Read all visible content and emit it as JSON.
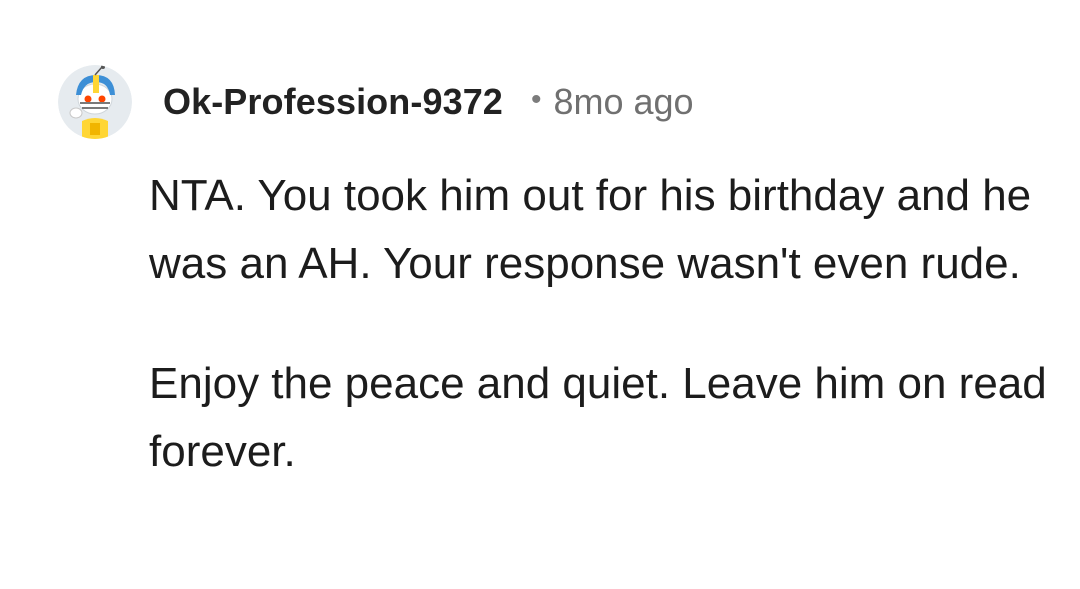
{
  "comment": {
    "author": "Ok-Profession-9372",
    "separator": "•",
    "timestamp": "8mo ago",
    "avatar_icon": "snoo-football-helmet-avatar",
    "paragraphs": [
      "NTA. You took him out for his birthday and he was an AH. Your response wasn't even rude.",
      "Enjoy the peace and quiet. Leave him on read forever."
    ]
  },
  "colors": {
    "background": "#ffffff",
    "text": "#1c1c1c",
    "meta": "#707070",
    "avatar_bg": "#e6ebef",
    "helmet_blue": "#3d8fd6",
    "snoo_orange": "#ff4500",
    "jersey_yellow": "#ffd635"
  }
}
